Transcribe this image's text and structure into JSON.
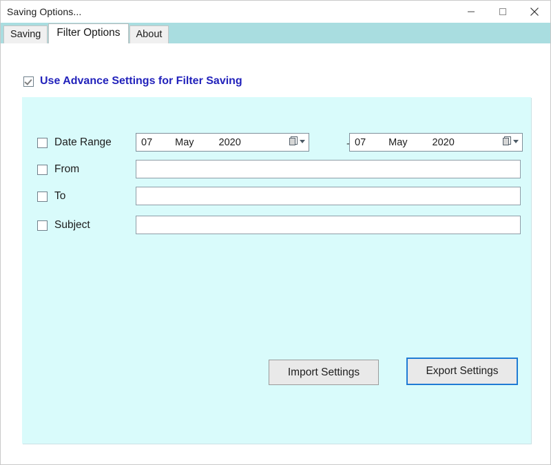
{
  "window": {
    "title": "Saving Options...",
    "controls": [
      {
        "name": "minimize",
        "glyph": "minimize-icon"
      },
      {
        "name": "maximize",
        "glyph": "maximize-icon"
      },
      {
        "name": "close",
        "glyph": "close-icon"
      }
    ]
  },
  "tabs": [
    {
      "label": "Saving",
      "active": false
    },
    {
      "label": "Filter Options",
      "active": true
    },
    {
      "label": "About",
      "active": false
    }
  ],
  "advance": {
    "label": "Use Advance Settings for Filter Saving",
    "checked": true,
    "color": "#2222bb"
  },
  "filters": {
    "date_range": {
      "label": "Date Range",
      "checked": false,
      "separator": "-",
      "start": {
        "day": "07",
        "month": "May",
        "year": "2020"
      },
      "end": {
        "day": "07",
        "month": "May",
        "year": "2020"
      },
      "dropdown_icon": "calendar-dropdown-icon"
    },
    "from": {
      "label": "From",
      "checked": false,
      "value": "",
      "placeholder": ""
    },
    "to": {
      "label": "To",
      "checked": false,
      "value": "",
      "placeholder": ""
    },
    "subject": {
      "label": "Subject",
      "checked": false,
      "value": "",
      "placeholder": ""
    }
  },
  "actions": {
    "import_label": "Import Settings",
    "export_label": "Export Settings",
    "focus_color": "#1e7ad4"
  },
  "theme": {
    "panel_bg": "#d9fbfb",
    "tabstrip_bg": "#a9dde0",
    "window_bg": "#ffffff"
  }
}
